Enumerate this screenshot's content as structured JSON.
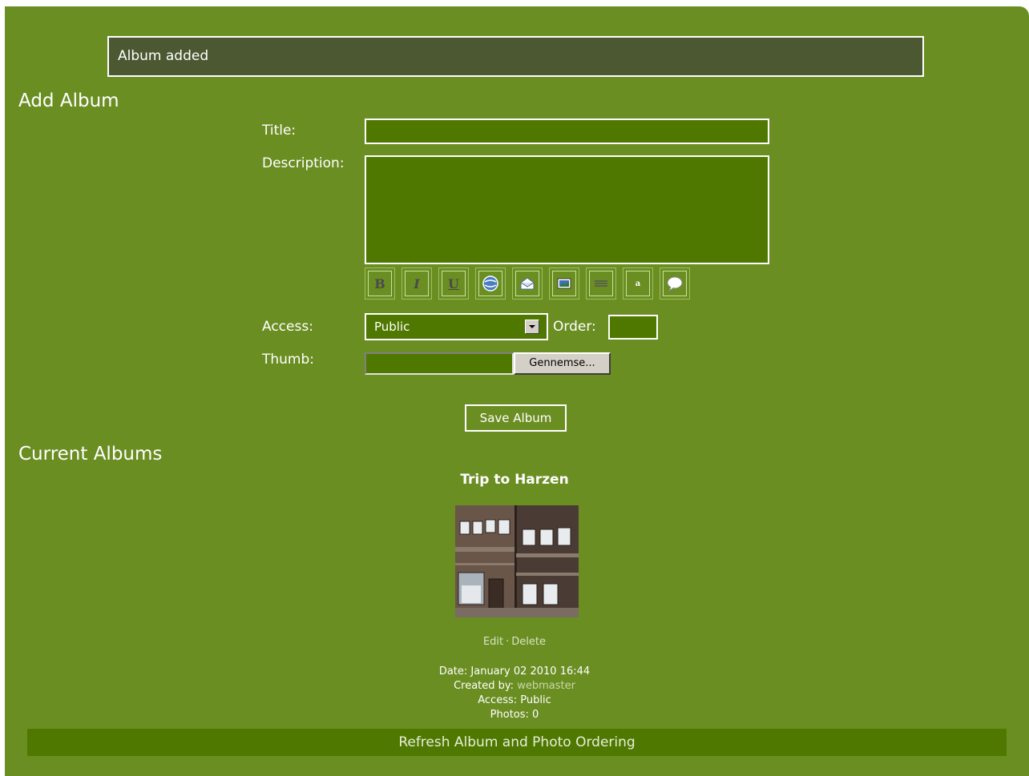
{
  "notice": {
    "text": "Album added"
  },
  "add_album": {
    "heading": "Add Album",
    "labels": {
      "title": "Title:",
      "description": "Description:",
      "access": "Access:",
      "order": "Order:",
      "thumb": "Thumb:"
    },
    "title_value": "",
    "description_value": "",
    "toolbar": [
      {
        "icon": "bold-icon",
        "glyph": "B"
      },
      {
        "icon": "italic-icon",
        "glyph": "I"
      },
      {
        "icon": "underline-icon",
        "glyph": "U"
      },
      {
        "icon": "link-globe-icon",
        "glyph": ""
      },
      {
        "icon": "email-icon",
        "glyph": ""
      },
      {
        "icon": "image-icon",
        "glyph": ""
      },
      {
        "icon": "horizontal-rule-icon",
        "glyph": ""
      },
      {
        "icon": "small-text-icon",
        "glyph": "a"
      },
      {
        "icon": "quote-bubble-icon",
        "glyph": ""
      }
    ],
    "access_value": "Public",
    "order_value": "",
    "browse_label": "Gennemse...",
    "save_label": "Save Album"
  },
  "current_albums": {
    "heading": "Current Albums",
    "albums": [
      {
        "title": "Trip to Harzen",
        "edit_label": "Edit",
        "separator": "·",
        "delete_label": "Delete",
        "date_label": "Date:",
        "date_value": "January 02 2010 16:44",
        "created_label": "Created by:",
        "created_value": "webmaster",
        "access_label": "Access:",
        "access_value": "Public",
        "photos_label": "Photos:",
        "photos_value": "0"
      }
    ]
  },
  "refresh_label": "Refresh Album and Photo Ordering",
  "colors": {
    "panel": "#6b8e23",
    "field": "#4f7800",
    "notice": "#4b5832"
  }
}
